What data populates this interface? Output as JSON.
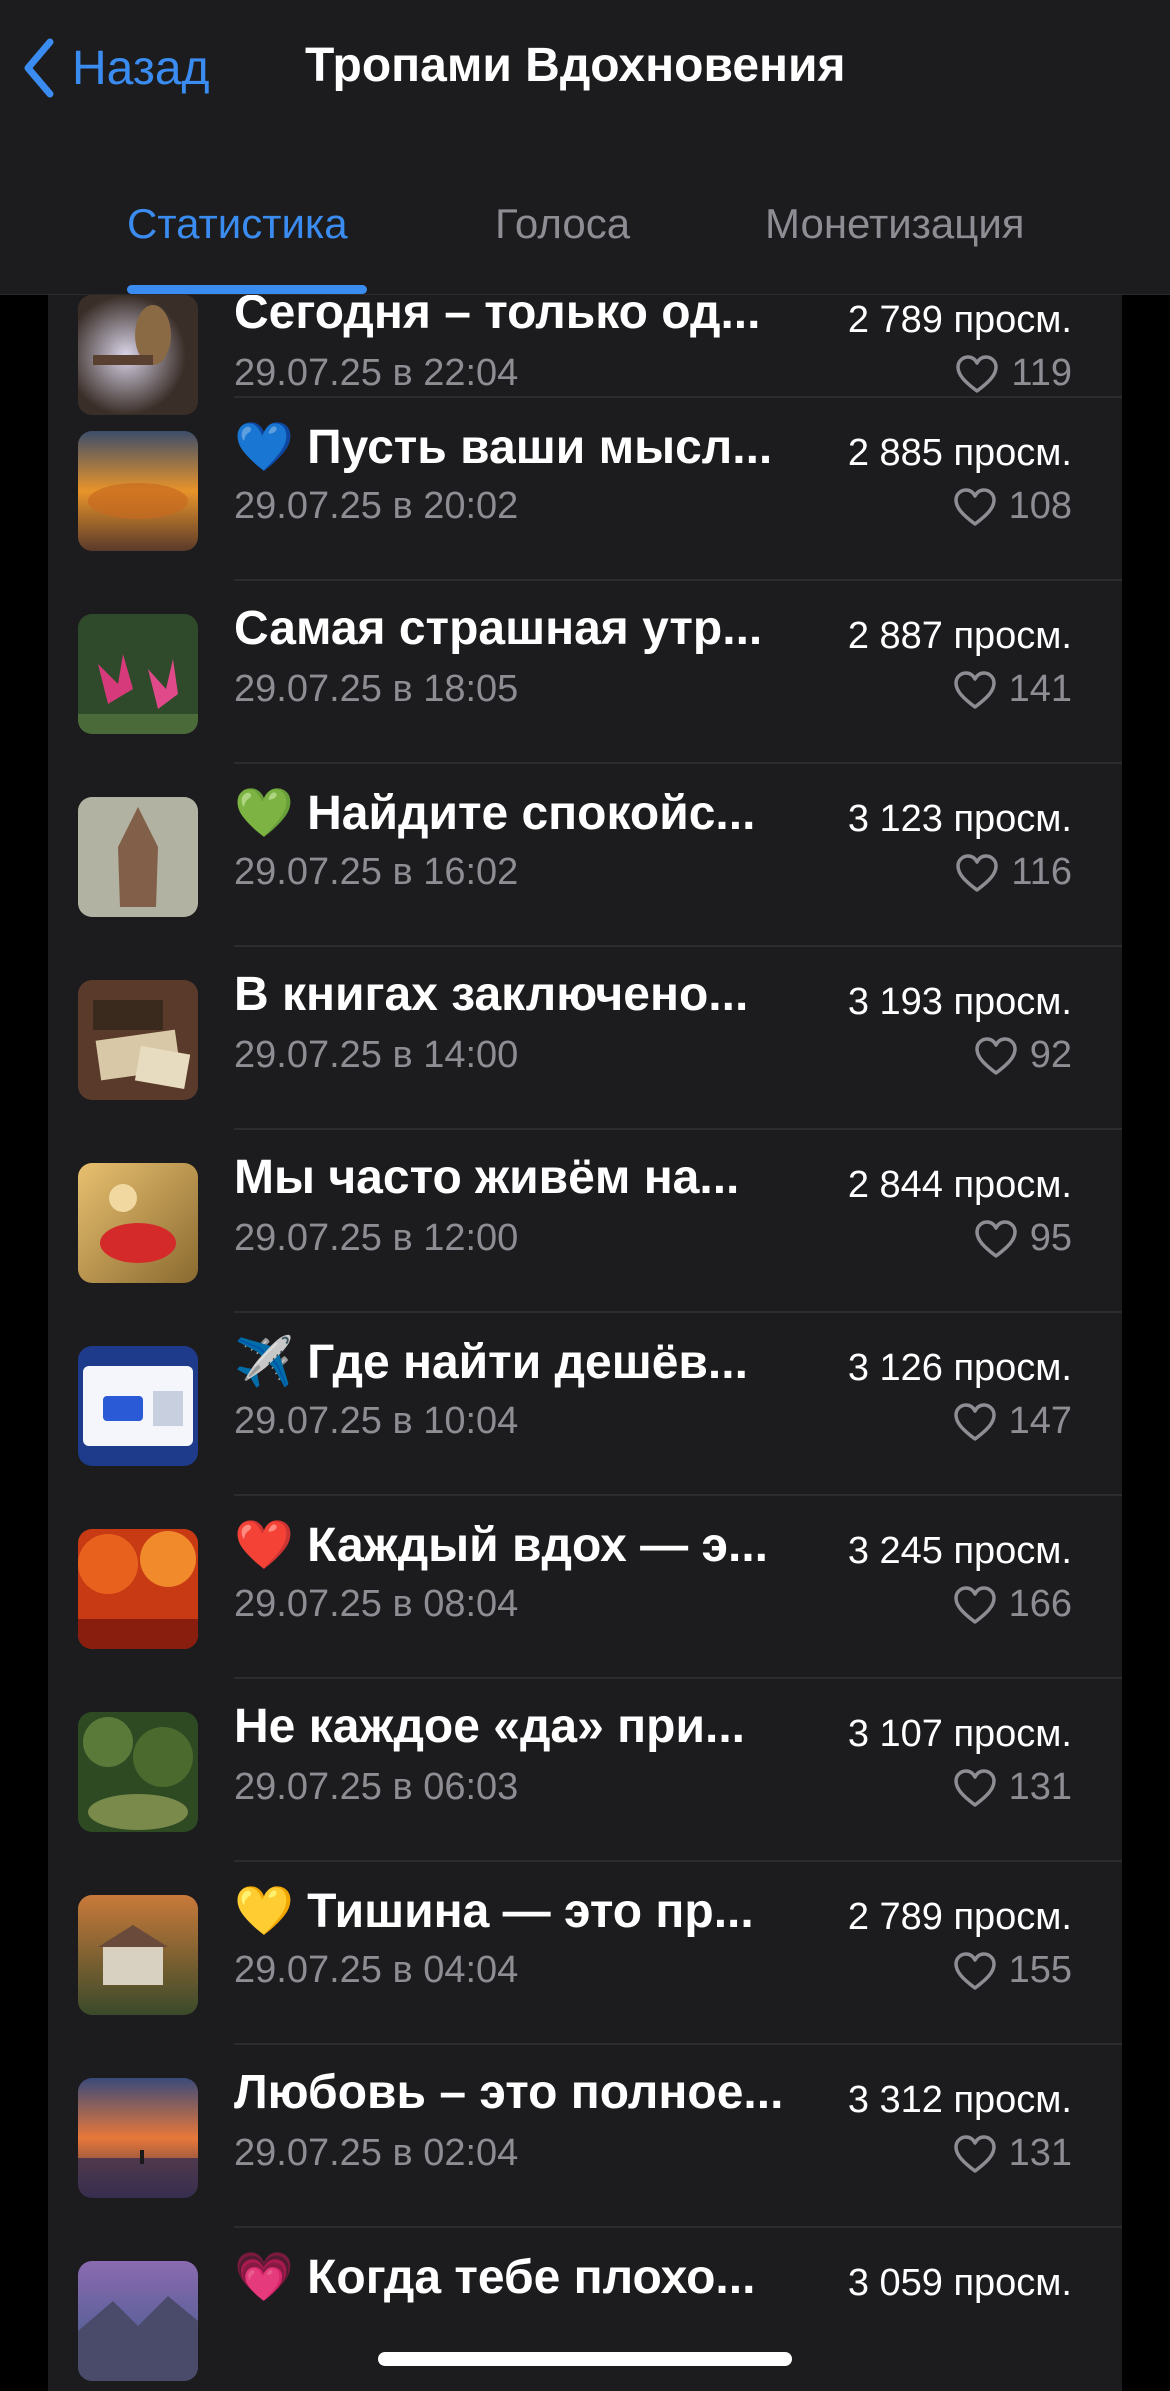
{
  "header": {
    "back_label": "Назад",
    "title": "Тропами Вдохновения"
  },
  "tabs": [
    {
      "label": "Статистика",
      "active": true
    },
    {
      "label": "Голоса",
      "active": false
    },
    {
      "label": "Монетизация",
      "active": false
    }
  ],
  "posts": [
    {
      "title": "Сегодня – только од...",
      "date": "29.07.25 в 22:04",
      "views": "2 789 просм.",
      "likes": "119"
    },
    {
      "title": "💙 Пусть ваши мысл...",
      "date": "29.07.25 в 20:02",
      "views": "2 885 просм.",
      "likes": "108"
    },
    {
      "title": "Самая страшная утр...",
      "date": "29.07.25 в 18:05",
      "views": "2 887 просм.",
      "likes": "141"
    },
    {
      "title": "💚 Найдите спокойс...",
      "date": "29.07.25 в 16:02",
      "views": "3 123 просм.",
      "likes": "116"
    },
    {
      "title": "В книгах заключено...",
      "date": "29.07.25 в 14:00",
      "views": "3 193 просм.",
      "likes": "92"
    },
    {
      "title": "Мы часто живём на...",
      "date": "29.07.25 в 12:00",
      "views": "2 844 просм.",
      "likes": "95"
    },
    {
      "title": "✈️ Где найти дешёв...",
      "date": "29.07.25 в 10:04",
      "views": "3 126 просм.",
      "likes": "147"
    },
    {
      "title": "❤️ Каждый вдох — э...",
      "date": "29.07.25 в 08:04",
      "views": "3 245 просм.",
      "likes": "166"
    },
    {
      "title": "Не каждое «да» при...",
      "date": "29.07.25 в 06:03",
      "views": "3 107 просм.",
      "likes": "131"
    },
    {
      "title": "💛 Тишина — это пр...",
      "date": "29.07.25 в 04:04",
      "views": "2 789 просм.",
      "likes": "155"
    },
    {
      "title": "Любовь – это полное...",
      "date": "29.07.25 в 02:04",
      "views": "3 312 просм.",
      "likes": "131"
    },
    {
      "title": "💗 Когда тебе плохо...",
      "date": "",
      "views": "3 059 просм.",
      "likes": ""
    }
  ]
}
